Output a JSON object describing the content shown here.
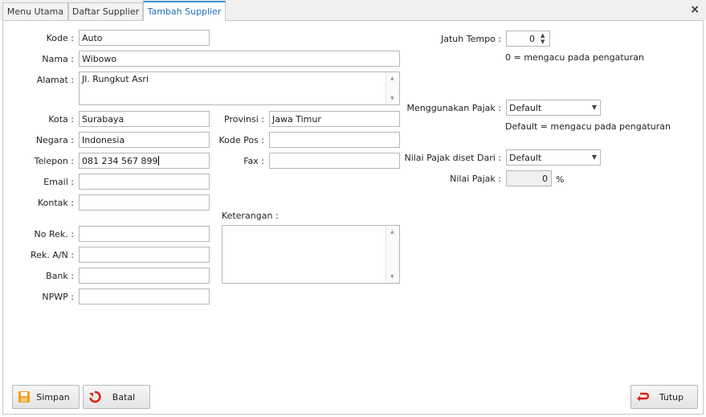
{
  "tabs": {
    "menu_utama": "Menu Utama",
    "daftar_supplier": "Daftar Supplier",
    "tambah_supplier": "Tambah Supplier",
    "close": "×"
  },
  "form": {
    "kode": {
      "label": "Kode :",
      "value": "Auto"
    },
    "nama": {
      "label": "Nama :",
      "value": "Wibowo"
    },
    "alamat": {
      "label": "Alamat :",
      "value": "Jl. Rungkut Asri"
    },
    "kota": {
      "label": "Kota :",
      "value": "Surabaya"
    },
    "provinsi": {
      "label": "Provinsi :",
      "value": "Jawa Timur"
    },
    "negara": {
      "label": "Negara :",
      "value": "Indonesia"
    },
    "kode_pos": {
      "label": "Kode Pos :",
      "value": ""
    },
    "telepon": {
      "label": "Telepon :",
      "value": "081 234 567 899"
    },
    "fax": {
      "label": "Fax :",
      "value": ""
    },
    "email": {
      "label": "Email :",
      "value": ""
    },
    "kontak": {
      "label": "Kontak :",
      "value": ""
    },
    "keterangan": {
      "label": "Keterangan :",
      "value": ""
    },
    "no_rek": {
      "label": "No Rek. :",
      "value": ""
    },
    "rek_an": {
      "label": "Rek. A/N :",
      "value": ""
    },
    "bank": {
      "label": "Bank :",
      "value": ""
    },
    "npwp": {
      "label": "NPWP :",
      "value": ""
    }
  },
  "right": {
    "jatuh_tempo": {
      "label": "Jatuh Tempo :",
      "value": "0",
      "hint": "0 = mengacu pada pengaturan"
    },
    "menggunakan_pajak": {
      "label": "Menggunakan Pajak :",
      "selected": "Default",
      "hint": "Default = mengacu pada pengaturan"
    },
    "nilai_pajak_diset_dari": {
      "label": "Nilai Pajak diset Dari :",
      "selected": "Default"
    },
    "nilai_pajak": {
      "label": "Nilai Pajak :",
      "value": "0",
      "unit": "%"
    }
  },
  "buttons": {
    "simpan": "Simpan",
    "batal": "Batal",
    "tutup": "Tutup"
  },
  "icons": {
    "save": "floppy-disk-icon",
    "cancel": "undo-icon",
    "close": "return-icon"
  },
  "colors": {
    "active_tab_text": "#1e6fb8",
    "active_tab_border": "#3a8fd6",
    "icon_red": "#d9251c",
    "icon_orange": "#f0a020"
  }
}
